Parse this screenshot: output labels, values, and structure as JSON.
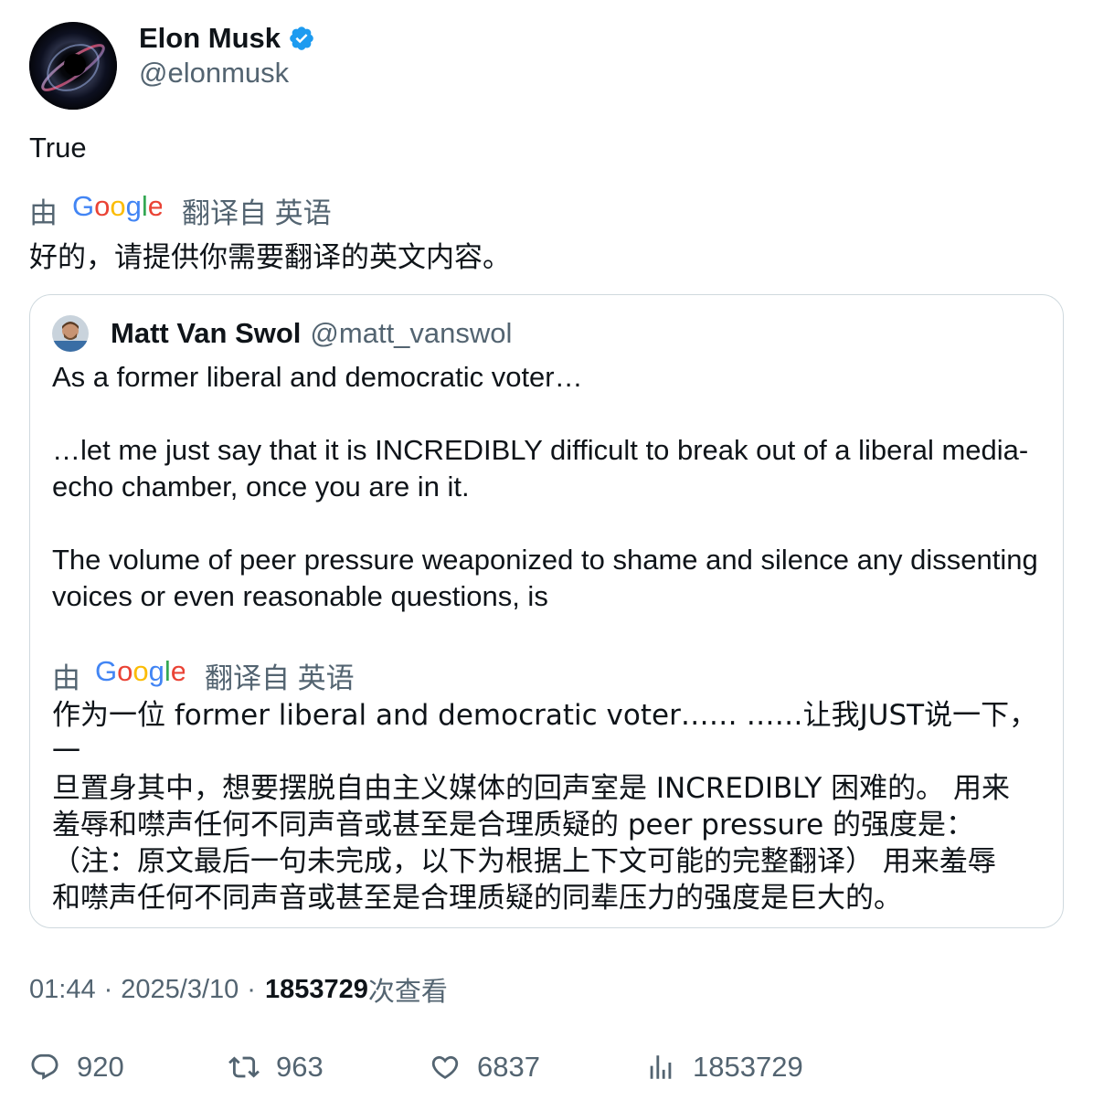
{
  "author": {
    "display_name": "Elon Musk",
    "handle": "@elonmusk",
    "verified_icon": "verified-badge-icon"
  },
  "tweet": {
    "text": "True"
  },
  "translation_note": {
    "by": "由",
    "provider": "Google",
    "label": "翻译自 英语"
  },
  "tweet_translation": "好的，请提供你需要翻译的英文内容。",
  "quote": {
    "display_name": "Matt Van Swol",
    "handle": "@matt_vanswol",
    "paragraphs": [
      "As a former liberal and democratic voter…",
      "…let me just say that it is INCREDIBLY difficult to break out of a liberal media-echo chamber, once you are in it.",
      "The volume of peer pressure weaponized to shame and silence any dissenting voices or even reasonable questions, is"
    ],
    "translation_note": {
      "by": "由",
      "provider": "Google",
      "label": "翻译自 英语"
    },
    "translation_lines": [
      "作为一位 former liberal and democratic voter…… ……让我JUST说一下，一",
      "旦置身其中，想要摆脱自由主义媒体的回声室是 INCREDIBLY 困难的。 用来",
      "羞辱和噤声任何不同声音或甚至是合理质疑的 peer pressure 的强度是：",
      "（注：原文最后一句未完成，以下为根据上下文可能的完整翻译） 用来羞辱",
      "和噤声任何不同声音或甚至是合理质疑的同辈压力的强度是巨大的。"
    ]
  },
  "meta": {
    "time": "01:44",
    "sep1": "·",
    "date": "2025/3/10",
    "sep2": "·",
    "views_count": "1853729",
    "views_label": "次查看"
  },
  "actions": {
    "replies": "920",
    "retweets": "963",
    "likes": "6837",
    "views": "1853729"
  },
  "colors": {
    "text": "#0f1419",
    "secondary": "#536471",
    "verified": "#1d9bf0",
    "border": "#cfd9de"
  }
}
